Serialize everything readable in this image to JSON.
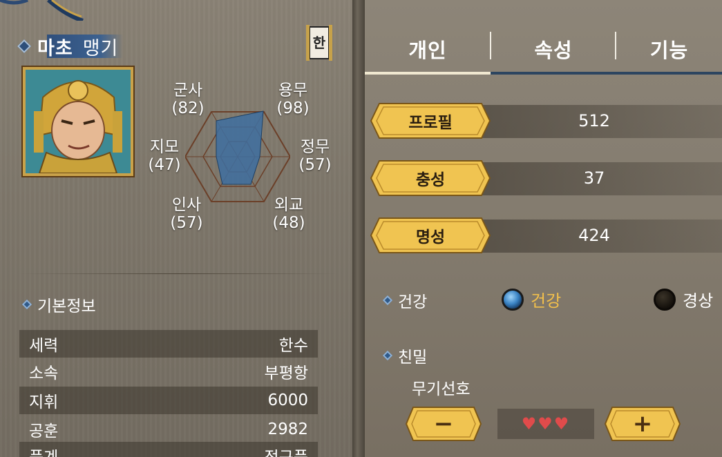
{
  "general": {
    "name": "마초",
    "style": "맹기",
    "lang_badge": "한"
  },
  "stats": {
    "military": {
      "label": "군사",
      "value": "(82)"
    },
    "valor": {
      "label": "용무",
      "value": "(98)"
    },
    "intellect": {
      "label": "지모",
      "value": "(47)"
    },
    "politics": {
      "label": "정무",
      "value": "(57)"
    },
    "charisma": {
      "label": "인사",
      "value": "(57)"
    },
    "diplomacy": {
      "label": "외교",
      "value": "(48)"
    }
  },
  "basic_info": {
    "title": "기본정보",
    "rows": [
      {
        "label": "세력",
        "value": "한수"
      },
      {
        "label": "소속",
        "value": "부평항"
      },
      {
        "label": "지휘",
        "value": "6000"
      },
      {
        "label": "공훈",
        "value": "2982"
      },
      {
        "label": "품계",
        "value": "정구품"
      }
    ]
  },
  "tabs": [
    "개인",
    "속성",
    "기능"
  ],
  "personal": {
    "rows": [
      {
        "label": "프로필",
        "value": "512"
      },
      {
        "label": "충성",
        "value": "37"
      },
      {
        "label": "명성",
        "value": "424"
      }
    ],
    "health": {
      "title": "건강",
      "option_on": "건강",
      "option_off": "경상"
    },
    "intimacy": {
      "title": "친밀",
      "sub": "무기선호",
      "hearts": "♥♥♥",
      "minus": "−",
      "plus": "+"
    }
  },
  "colors": {
    "accent_gold": "#f0c451",
    "selected_text": "#f3c04b",
    "heart": "#e04b4b",
    "tab_underline": "#2c4560"
  }
}
